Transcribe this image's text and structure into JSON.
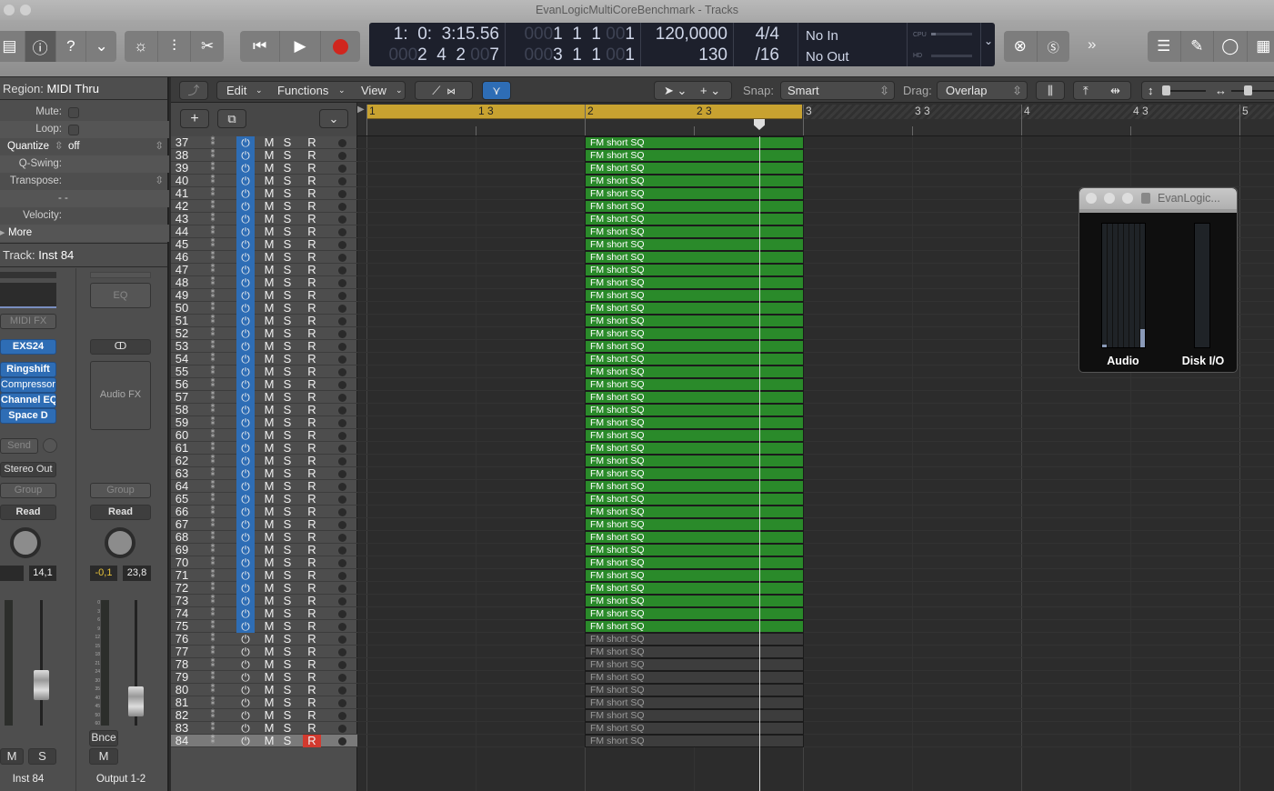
{
  "window": {
    "title": "EvanLogicMultiCoreBenchmark - Tracks"
  },
  "control_bar": {
    "view_buttons": [
      "library-icon",
      "inspector-icon",
      "quick-help-icon",
      "toolbar-icon"
    ],
    "edit_buttons": [
      "smart-controls-icon",
      "mixer-icon",
      "editors-icon"
    ],
    "transport": [
      "rewind-icon",
      "play-icon",
      "record-icon"
    ],
    "lcd": {
      "time": "1:  0:  3:15.56",
      "time_sub_dim": "000",
      "time_sub": "2  4  2",
      "time_sub_dim2": "00",
      "time_sub2": "7",
      "pos_dim": "000",
      "pos": "1  1  1",
      "pos_dim2": "00",
      "pos2": "1",
      "pos_b_dim": "000",
      "pos_b": "3  1  1",
      "pos_b_dim2": "00",
      "pos_b2": "1",
      "tempo": "120,0000",
      "bpm_display": "130",
      "signature": "4/4",
      "division": "/16",
      "midi_in": "No In",
      "midi_out": "No Out",
      "cpu_label": "CPU",
      "hd_label": "HD",
      "cpu_load": 0.1,
      "hd_load": 0.0
    },
    "right_buttons": [
      "low-latency-icon",
      "solo-icon",
      "more-icon",
      "list-editors-icon",
      "note-pad-icon",
      "loop-browser-icon",
      "browsers-icon"
    ]
  },
  "inspector": {
    "region_label": "Region:",
    "region_name": "MIDI Thru",
    "mute": "Mute:",
    "loop": "Loop:",
    "quantize": "Quantize",
    "quantize_value": "off",
    "qswing": "Q-Swing:",
    "transpose": "Transpose:",
    "dash": "- -",
    "velocity": "Velocity:",
    "more": "More",
    "track_label": "Track:",
    "track_name": "Inst 84",
    "strip1": {
      "midi_fx": "MIDI FX",
      "instrument": "EXS24",
      "plugins": [
        "Ringshift",
        "Compressor",
        "Channel EQ",
        "Space D"
      ],
      "send": "Send",
      "output": "Stereo Out",
      "group": "Group",
      "automation": "Read",
      "value": "14,1",
      "mute": "M",
      "solo": "S",
      "name": "Inst 84"
    },
    "strip2": {
      "eq": "EQ",
      "link": "ↀ",
      "audio_fx": "Audio FX",
      "group": "Group",
      "automation": "Read",
      "pan_value": "-0,1",
      "value": "23,8",
      "bounce": "Bnce",
      "mute": "M",
      "name": "Output 1-2"
    },
    "fader_scale": [
      "0",
      "3",
      "6",
      "9",
      "12",
      "15",
      "18",
      "21",
      "24",
      "30",
      "35",
      "40",
      "45",
      "50",
      "60"
    ]
  },
  "tracks_toolbar": {
    "edit": "Edit",
    "functions": "Functions",
    "view": "View",
    "snap_label": "Snap:",
    "snap_value": "Smart",
    "drag_label": "Drag:",
    "drag_value": "Overlap"
  },
  "ruler": {
    "labels": [
      "1",
      "1 3",
      "2",
      "2 3",
      "3",
      "3 3",
      "4",
      "4 3",
      "5"
    ],
    "cycle": "1 - 3",
    "playhead_bar": 2.8
  },
  "colors": {
    "region_active": "#2a8a2a",
    "region_inactive": "#3d3d3d",
    "cycle": "#c8a230",
    "power_on": "#2e6db5",
    "record_armed": "#d23a2f"
  },
  "tracks": [
    {
      "num": "37",
      "region": "FM short SQ",
      "on": true
    },
    {
      "num": "38",
      "region": "FM short SQ",
      "on": true
    },
    {
      "num": "39",
      "region": "FM short SQ",
      "on": true
    },
    {
      "num": "40",
      "region": "FM short SQ",
      "on": true
    },
    {
      "num": "41",
      "region": "FM short SQ",
      "on": true
    },
    {
      "num": "42",
      "region": "FM short SQ",
      "on": true
    },
    {
      "num": "43",
      "region": "FM short SQ",
      "on": true
    },
    {
      "num": "44",
      "region": "FM short SQ",
      "on": true
    },
    {
      "num": "45",
      "region": "FM short SQ",
      "on": true
    },
    {
      "num": "46",
      "region": "FM short SQ",
      "on": true
    },
    {
      "num": "47",
      "region": "FM short SQ",
      "on": true
    },
    {
      "num": "48",
      "region": "FM short SQ",
      "on": true
    },
    {
      "num": "49",
      "region": "FM short SQ",
      "on": true
    },
    {
      "num": "50",
      "region": "FM short SQ",
      "on": true
    },
    {
      "num": "51",
      "region": "FM short SQ",
      "on": true
    },
    {
      "num": "52",
      "region": "FM short SQ",
      "on": true
    },
    {
      "num": "53",
      "region": "FM short SQ",
      "on": true
    },
    {
      "num": "54",
      "region": "FM short SQ",
      "on": true
    },
    {
      "num": "55",
      "region": "FM short SQ",
      "on": true
    },
    {
      "num": "56",
      "region": "FM short SQ",
      "on": true
    },
    {
      "num": "57",
      "region": "FM short SQ",
      "on": true
    },
    {
      "num": "58",
      "region": "FM short SQ",
      "on": true
    },
    {
      "num": "59",
      "region": "FM short SQ",
      "on": true
    },
    {
      "num": "60",
      "region": "FM short SQ",
      "on": true
    },
    {
      "num": "61",
      "region": "FM short SQ",
      "on": true
    },
    {
      "num": "62",
      "region": "FM short SQ",
      "on": true
    },
    {
      "num": "63",
      "region": "FM short SQ",
      "on": true
    },
    {
      "num": "64",
      "region": "FM short SQ",
      "on": true
    },
    {
      "num": "65",
      "region": "FM short SQ",
      "on": true
    },
    {
      "num": "66",
      "region": "FM short SQ",
      "on": true
    },
    {
      "num": "67",
      "region": "FM short SQ",
      "on": true
    },
    {
      "num": "68",
      "region": "FM short SQ",
      "on": true
    },
    {
      "num": "69",
      "region": "FM short SQ",
      "on": true
    },
    {
      "num": "70",
      "region": "FM short SQ",
      "on": true
    },
    {
      "num": "71",
      "region": "FM short SQ",
      "on": true
    },
    {
      "num": "72",
      "region": "FM short SQ",
      "on": true
    },
    {
      "num": "73",
      "region": "FM short SQ",
      "on": true
    },
    {
      "num": "74",
      "region": "FM short SQ",
      "on": true
    },
    {
      "num": "75",
      "region": "FM short SQ",
      "on": true
    },
    {
      "num": "76",
      "region": "FM short SQ",
      "on": false
    },
    {
      "num": "77",
      "region": "FM short SQ",
      "on": false
    },
    {
      "num": "78",
      "region": "FM short SQ",
      "on": false
    },
    {
      "num": "79",
      "region": "FM short SQ",
      "on": false
    },
    {
      "num": "80",
      "region": "FM short SQ",
      "on": false
    },
    {
      "num": "81",
      "region": "FM short SQ",
      "on": false
    },
    {
      "num": "82",
      "region": "FM short SQ",
      "on": false
    },
    {
      "num": "83",
      "region": "FM short SQ",
      "on": false
    },
    {
      "num": "84",
      "region": "FM short SQ",
      "on": false,
      "selected": true,
      "armed": true
    }
  ],
  "track_buttons": {
    "mute": "M",
    "solo": "S",
    "record": "R"
  },
  "meter_window": {
    "title": "EvanLogic...",
    "audio_label": "Audio",
    "disk_label": "Disk I/O",
    "audio_loads": [
      0.02,
      0,
      0,
      0,
      0,
      0,
      0,
      0.15
    ],
    "disk_load": 0
  }
}
